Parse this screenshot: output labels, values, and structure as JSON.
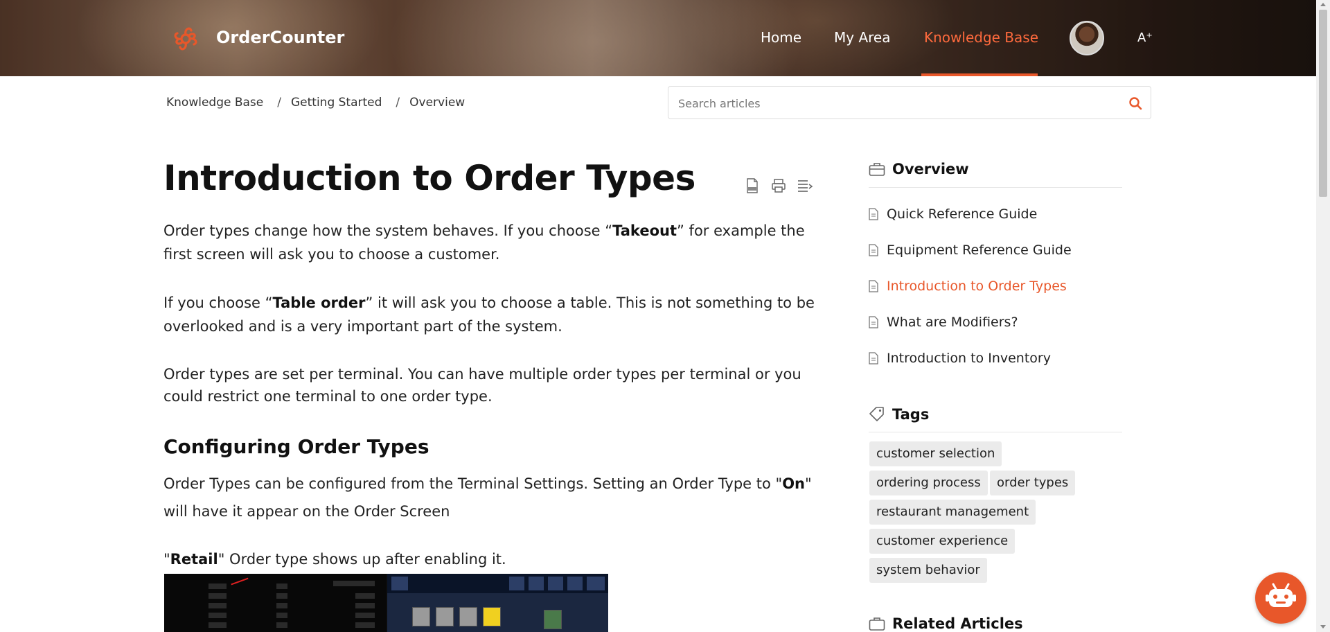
{
  "brand": {
    "name": "OrderCounter",
    "accent": "#e8572a"
  },
  "nav": {
    "items": [
      {
        "label": "Home",
        "active": false
      },
      {
        "label": "My Area",
        "active": false
      },
      {
        "label": "Knowledge Base",
        "active": true
      }
    ],
    "font_size_icon": "A⁺"
  },
  "breadcrumb": [
    "Knowledge Base",
    "Getting Started",
    "Overview"
  ],
  "breadcrumb_sep": "/",
  "search": {
    "placeholder": "Search articles",
    "value": ""
  },
  "article": {
    "title": "Introduction to Order Types",
    "p1_pre": "Order types change how the system behaves. If you choose “",
    "p1_bold": "Takeout",
    "p1_post": "” for example the first screen will ask you to choose a customer.",
    "p2_pre": "If you choose “",
    "p2_bold": "Table order",
    "p2_post": "” it will ask you to choose a table. This is not something to be overlooked and is a very important part of the system.",
    "p3": "Order types are set per terminal. You can have multiple order types per terminal or you could restrict one terminal to one order type.",
    "section_title": "Configuring Order Types",
    "p4_pre": "Order Types can be configured from the Terminal Settings. Setting an Order Type to \"",
    "p4_bold": "On",
    "p4_post": "\" will have it appear on the Order Screen",
    "p5_pre": "\"",
    "p5_bold": "Retail",
    "p5_post": "\" Order type shows up after enabling it."
  },
  "sidebar": {
    "overview_title": "Overview",
    "articles": [
      {
        "label": "Quick Reference Guide",
        "active": false
      },
      {
        "label": "Equipment Reference Guide",
        "active": false
      },
      {
        "label": "Introduction to Order Types",
        "active": true
      },
      {
        "label": "What are Modifiers?",
        "active": false
      },
      {
        "label": "Introduction to Inventory",
        "active": false
      }
    ],
    "tags_title": "Tags",
    "tags": [
      "customer selection",
      "ordering process",
      "order types",
      "restaurant management",
      "customer experience",
      "system behavior"
    ],
    "related_title": "Related Articles"
  }
}
